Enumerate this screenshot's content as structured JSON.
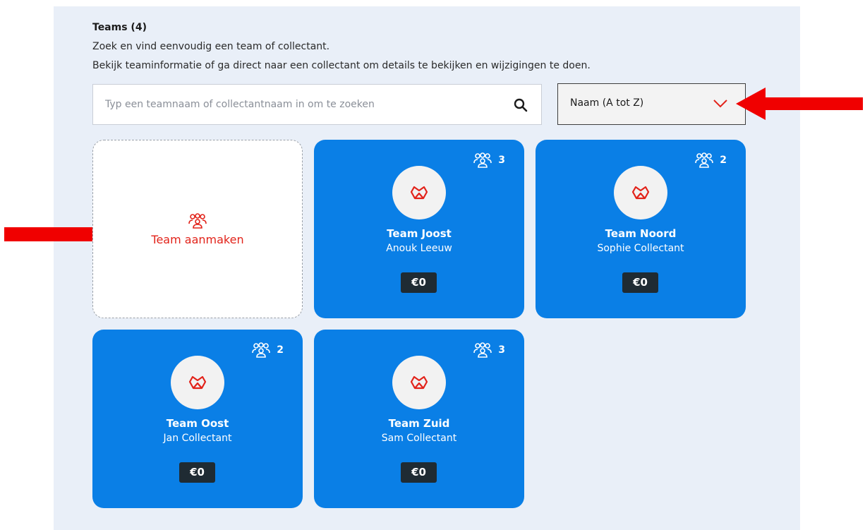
{
  "header": {
    "title": "Teams (4)",
    "line1": "Zoek en vind eenvoudig een team of collectant.",
    "line2": "Bekijk teaminformatie of ga direct naar een collectant om details te bekijken en wijzigingen te doen."
  },
  "search": {
    "placeholder": "Typ een teamnaam of collectantnaam in om te zoeken",
    "value": ""
  },
  "sort": {
    "selected": "Naam (A tot Z)"
  },
  "create": {
    "label": "Team aanmaken"
  },
  "teams": [
    {
      "name": "Team Joost",
      "leader": "Anouk Leeuw",
      "members": "3",
      "amount": "€0"
    },
    {
      "name": "Team Noord",
      "leader": "Sophie Collectant",
      "members": "2",
      "amount": "€0"
    },
    {
      "name": "Team Oost",
      "leader": "Jan Collectant",
      "members": "2",
      "amount": "€0"
    },
    {
      "name": "Team Zuid",
      "leader": "Sam Collectant",
      "members": "3",
      "amount": "€0"
    }
  ],
  "colors": {
    "card": "#0a7fe6",
    "accent": "#e2231a",
    "panel": "#e9eff8",
    "annotation_arrow": "#f00000"
  },
  "icons": [
    "search-icon",
    "chevron-down-icon",
    "group-icon",
    "logo-icon",
    "annotation-arrow"
  ]
}
